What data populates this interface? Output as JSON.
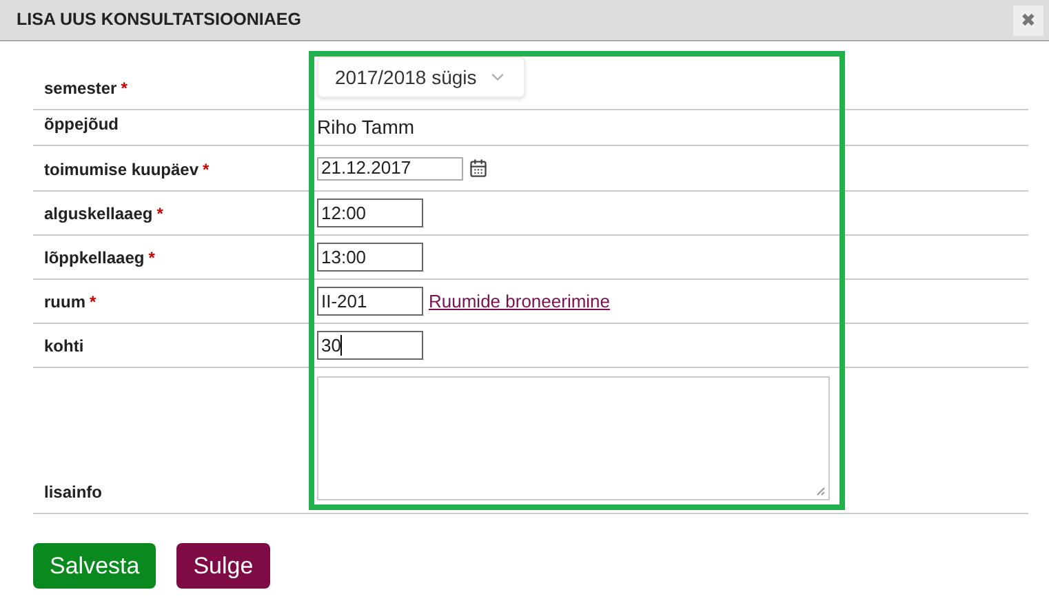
{
  "dialog": {
    "title": "LISA UUS KONSULTATSIOONIAEG",
    "close_label": "✖"
  },
  "fields": [
    {
      "label": "semester",
      "marker": "*",
      "kind": "select",
      "value": "2017/2018 sügis"
    },
    {
      "label": "õppejõud",
      "kind": "text",
      "value": "Riho Tamm"
    },
    {
      "label": "toimumise kuupäev",
      "marker": "*",
      "kind": "date",
      "value": "21.12.2017"
    },
    {
      "label": "alguskellaaeg",
      "marker": "*",
      "kind": "input",
      "value": "12:00"
    },
    {
      "label": "lõppkellaaeg",
      "marker": "*",
      "kind": "input",
      "value": "13:00"
    },
    {
      "label": "ruum",
      "marker": "*",
      "kind": "input",
      "value": "II-201",
      "link": "Ruumide broneerimine"
    },
    {
      "label": "kohti",
      "kind": "input",
      "value": "30",
      "focused": true
    },
    {
      "label": "lisainfo",
      "kind": "textarea"
    }
  ],
  "buttons": [
    {
      "label": "Salvesta",
      "kind": "primary"
    },
    {
      "label": "Sulge",
      "kind": "secondary"
    }
  ]
}
